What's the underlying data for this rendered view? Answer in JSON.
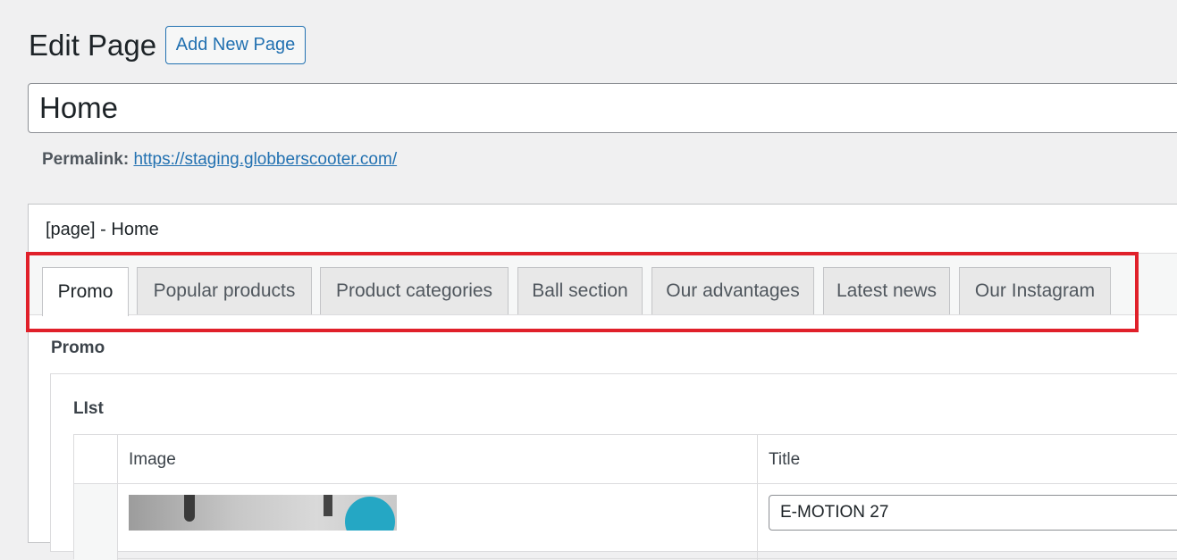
{
  "header": {
    "title": "Edit Page",
    "add_new_label": "Add New Page"
  },
  "post": {
    "title_value": "Home",
    "permalink_label": "Permalink:",
    "permalink_url": "https://staging.globberscooter.com/"
  },
  "metabox": {
    "title": "[page] - Home",
    "tabs": [
      {
        "label": "Promo",
        "active": true
      },
      {
        "label": "Popular products",
        "active": false
      },
      {
        "label": "Product categories",
        "active": false
      },
      {
        "label": "Ball section",
        "active": false
      },
      {
        "label": "Our advantages",
        "active": false
      },
      {
        "label": "Latest news",
        "active": false
      },
      {
        "label": "Our Instagram",
        "active": false
      }
    ],
    "section_label": "Promo",
    "list": {
      "label": "LIst",
      "columns": [
        "Image",
        "Title"
      ],
      "rows": [
        {
          "title_value": "E-MOTION 27"
        }
      ]
    }
  },
  "colors": {
    "accent": "#2271b1",
    "highlight": "#e0202a"
  }
}
